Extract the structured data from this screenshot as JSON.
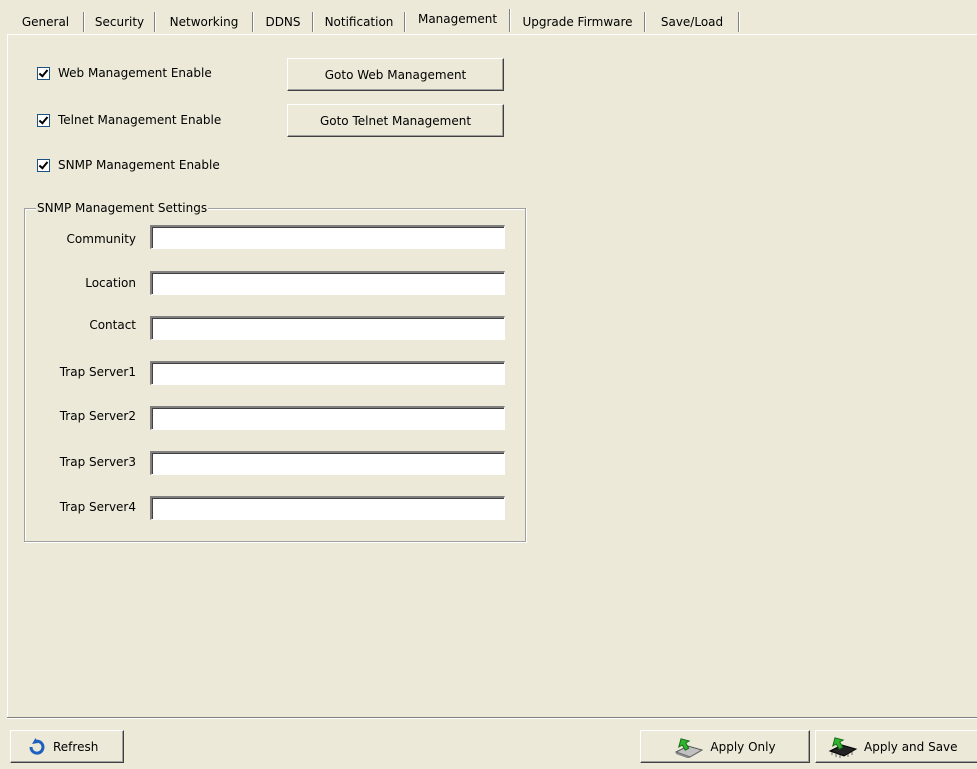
{
  "tabs": [
    {
      "label": "General"
    },
    {
      "label": "Security"
    },
    {
      "label": "Networking"
    },
    {
      "label": "DDNS"
    },
    {
      "label": "Notification"
    },
    {
      "label": "Management",
      "active": true
    },
    {
      "label": "Upgrade Firmware"
    },
    {
      "label": "Save/Load"
    }
  ],
  "management": {
    "web_enable": {
      "label": "Web Management Enable",
      "checked": true
    },
    "telnet_enable": {
      "label": "Telnet Management Enable",
      "checked": true
    },
    "snmp_enable": {
      "label": "SNMP Management Enable",
      "checked": true
    },
    "goto_web_label": "Goto Web Management",
    "goto_telnet_label": "Goto Telnet Management"
  },
  "snmp_settings": {
    "group_title": "SNMP Management Settings",
    "fields": [
      {
        "label": "Community",
        "value": ""
      },
      {
        "label": "Location",
        "value": ""
      },
      {
        "label": "Contact",
        "value": ""
      },
      {
        "label": "Trap Server1",
        "value": ""
      },
      {
        "label": "Trap Server2",
        "value": ""
      },
      {
        "label": "Trap Server3",
        "value": ""
      },
      {
        "label": "Trap Server4",
        "value": ""
      }
    ]
  },
  "footer": {
    "refresh_label": "Refresh",
    "apply_only_label": "Apply Only",
    "apply_save_label": "Apply and Save"
  },
  "icons": {
    "refresh": "refresh-arrow-icon",
    "apply_only": "apply-drive-icon",
    "apply_save": "save-chip-icon"
  }
}
